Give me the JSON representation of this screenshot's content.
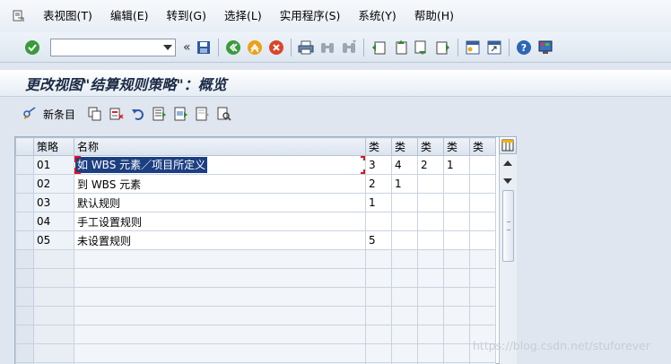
{
  "menu": {
    "items": [
      "表视图(T)",
      "编辑(E)",
      "转到(G)",
      "选择(L)",
      "实用程序(S)",
      "系统(Y)",
      "帮助(H)"
    ]
  },
  "toolbar": {
    "command_field_value": "",
    "chevron": "«"
  },
  "title": "更改视图\"结算规则策略\"：概览",
  "app_toolbar": {
    "new_entries_label": "新条目"
  },
  "table": {
    "headers": [
      "策略",
      "名称",
      "类",
      "类",
      "类",
      "类",
      "类"
    ],
    "rows": [
      [
        "01",
        "如 WBS 元素／项目所定义",
        "3",
        "4",
        "2",
        "1",
        ""
      ],
      [
        "02",
        "到 WBS 元素",
        "2",
        "1",
        "",
        "",
        ""
      ],
      [
        "03",
        "默认规则",
        "1",
        "",
        "",
        "",
        ""
      ],
      [
        "04",
        "手工设置规则",
        "",
        "",
        "",
        "",
        ""
      ],
      [
        "05",
        "未设置规则",
        "5",
        "",
        "",
        "",
        ""
      ]
    ],
    "empty_rows": 7
  },
  "watermark": "https://blog.csdn.net/stuforever",
  "colors": {
    "selection": "#1c3f82",
    "edit_corner": "#dd1122",
    "background": "#dfe6ef"
  }
}
